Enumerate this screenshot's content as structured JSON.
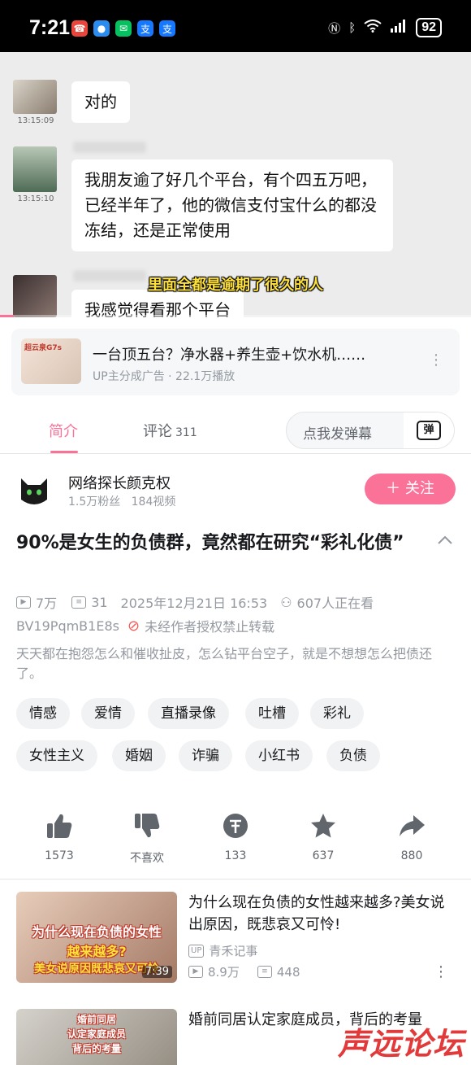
{
  "status_bar": {
    "time": "7:21",
    "battery": "92",
    "app_icons": [
      "alarm-app",
      "message-app",
      "wechat-app",
      "alipay-app",
      "alipay-app"
    ]
  },
  "video": {
    "messages": [
      {
        "time": "13:15:09",
        "text": "对的"
      },
      {
        "time": "13:15:10",
        "text": "我朋友逾了好几个平台，有个四五万吧，已经半年了，他的微信支付宝什么的都没冻结，还是正常使用"
      },
      {
        "time": "",
        "text": "我感觉得看那个平台"
      }
    ],
    "subtitle": "里面全都是逾期了很久的人",
    "progress": 0.03
  },
  "ad": {
    "thumb_text": "超云泉G7s",
    "title": "一台顶五台？净水器+养生壶+饮水机……",
    "subtitle": "UP主分成广告 · 22.1万播放"
  },
  "tabs": {
    "intro": "简介",
    "comments": "评论",
    "comments_count": "311",
    "danmu_placeholder": "点我发弹幕",
    "danmu_icon_label": "弹"
  },
  "uploader": {
    "name": "网络探长颜克权",
    "fans": "1.5万粉丝",
    "videos": "184视频",
    "follow_label": "＋ 关注"
  },
  "video_info": {
    "title": "90%是女生的负债群，竟然都在研究“彩礼化债”",
    "views": "7万",
    "danmaku": "31",
    "date": "2025年12月21日 16:53",
    "watching": "607人正在看",
    "bvid": "BV19PqmB1E8s",
    "copyright": "未经作者授权禁止转载",
    "description": "天天都在抱怨怎么和催收扯皮，怎么钻平台空子，就是不想想怎么把债还了。"
  },
  "tags": [
    "情感",
    "爱情",
    "直播录像",
    "吐槽",
    "彩礼",
    "女性主义",
    "婚姻",
    "诈骗",
    "小红书",
    "负债"
  ],
  "actions": {
    "like": "1573",
    "dislike": "不喜欢",
    "coin": "133",
    "favorite": "637",
    "share": "880"
  },
  "recommendations": [
    {
      "title": "为什么现在负债的女性越来越多?美女说出原因，既悲哀又可怜!",
      "thumb_text_1": "为什么现在负债的女性",
      "thumb_text_2": "越来越多?",
      "thumb_text_3": "美女说原因既悲哀又可怜",
      "duration": "7:39",
      "uploader": "青禾记事",
      "up_badge": "UP",
      "views": "8.9万",
      "danmaku": "448"
    },
    {
      "title": "婚前同居认定家庭成员，背后的考量",
      "thumb_text_1": "婚前同居",
      "thumb_text_2": "认定家庭成员",
      "thumb_text_3": "背后的考量"
    }
  ],
  "watermark": "声远论坛",
  "colors": {
    "accent": "#fb7299",
    "text_primary": "#18191c",
    "text_secondary": "#9499a0",
    "subtitle_yellow": "#ffe13b"
  }
}
